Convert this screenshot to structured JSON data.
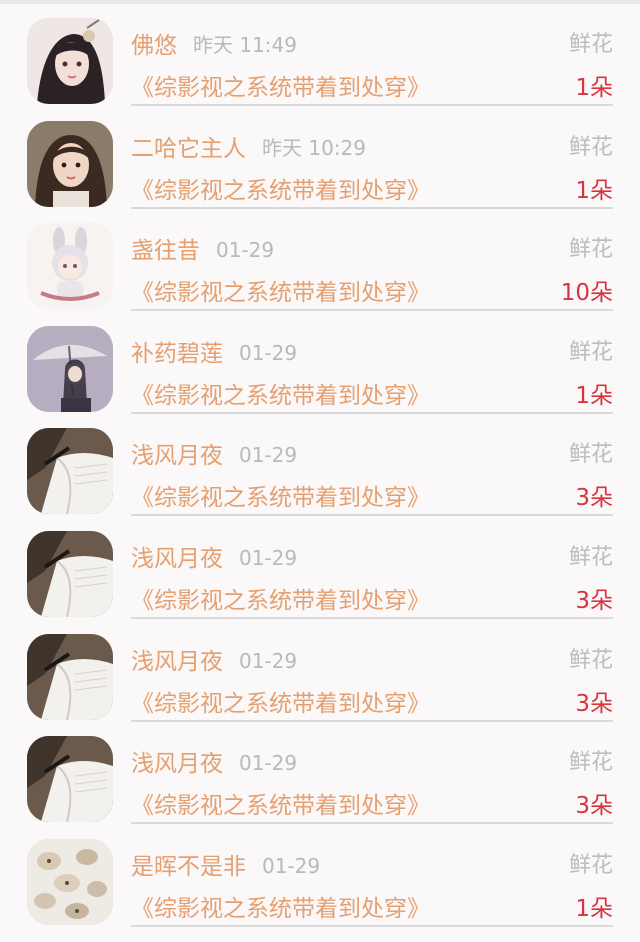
{
  "colors": {
    "accent": "#e6a070",
    "count": "#d8343f",
    "muted": "#b9b9b9"
  },
  "items": [
    {
      "name": "佛悠",
      "time": "昨天 11:49",
      "gift": "鲜花",
      "book": "《综影视之系统带着到处穿》",
      "count": "1朵",
      "avatar": "anime-girl-avatar"
    },
    {
      "name": "二哈它主人",
      "time": "昨天 10:29",
      "gift": "鲜花",
      "book": "《综影视之系统带着到处穿》",
      "count": "1朵",
      "avatar": "girl-photo-avatar"
    },
    {
      "name": "盏往昔",
      "time": "01-29",
      "gift": "鲜花",
      "book": "《综影视之系统带着到处穿》",
      "count": "10朵",
      "avatar": "chibi-bunny-avatar"
    },
    {
      "name": "补药碧莲",
      "time": "01-29",
      "gift": "鲜花",
      "book": "《综影视之系统带着到处穿》",
      "count": "1朵",
      "avatar": "umbrella-girl-avatar"
    },
    {
      "name": "浅风月夜",
      "time": "01-29",
      "gift": "鲜花",
      "book": "《综影视之系统带着到处穿》",
      "count": "3朵",
      "avatar": "open-book-avatar"
    },
    {
      "name": "浅风月夜",
      "time": "01-29",
      "gift": "鲜花",
      "book": "《综影视之系统带着到处穿》",
      "count": "3朵",
      "avatar": "open-book-avatar"
    },
    {
      "name": "浅风月夜",
      "time": "01-29",
      "gift": "鲜花",
      "book": "《综影视之系统带着到处穿》",
      "count": "3朵",
      "avatar": "open-book-avatar"
    },
    {
      "name": "浅风月夜",
      "time": "01-29",
      "gift": "鲜花",
      "book": "《综影视之系统带着到处穿》",
      "count": "3朵",
      "avatar": "open-book-avatar"
    },
    {
      "name": "是晖不是非",
      "time": "01-29",
      "gift": "鲜花",
      "book": "《综影视之系统带着到处穿》",
      "count": "1朵",
      "avatar": "cats-pattern-avatar"
    }
  ]
}
